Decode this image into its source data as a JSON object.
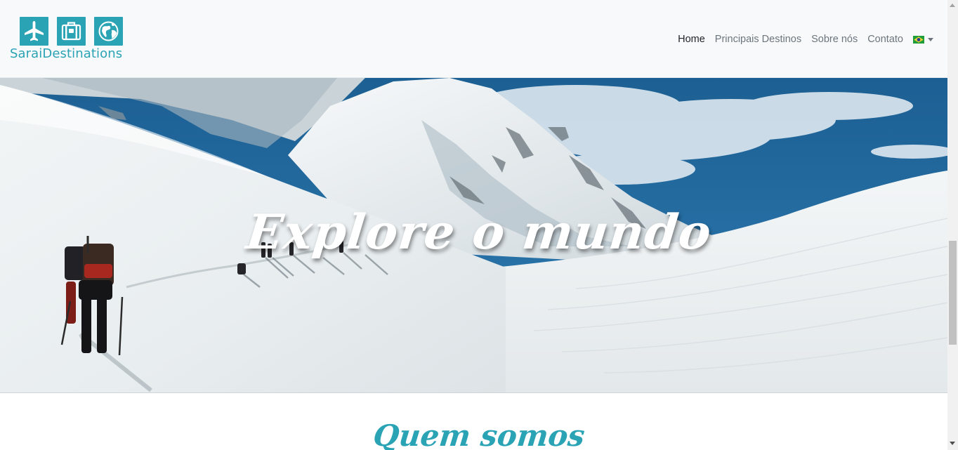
{
  "brand": {
    "name": "SaraiDestinations",
    "color": "#2aa3b5",
    "icons": [
      "airplane-icon",
      "suitcase-icon",
      "globe-icon"
    ]
  },
  "nav": {
    "items": [
      {
        "label": "Home",
        "active": true
      },
      {
        "label": "Principais Destinos",
        "active": false
      },
      {
        "label": "Sobre nós",
        "active": false
      },
      {
        "label": "Contato",
        "active": false
      }
    ],
    "language_icon": "brazil-flag-icon"
  },
  "hero": {
    "title": "Explore o mundo"
  },
  "about": {
    "title": "Quem somos"
  },
  "colors": {
    "accent": "#2aa3b5",
    "nav_bg": "#f8f9fa",
    "nav_text": "#6c757d",
    "nav_active": "#212529"
  }
}
